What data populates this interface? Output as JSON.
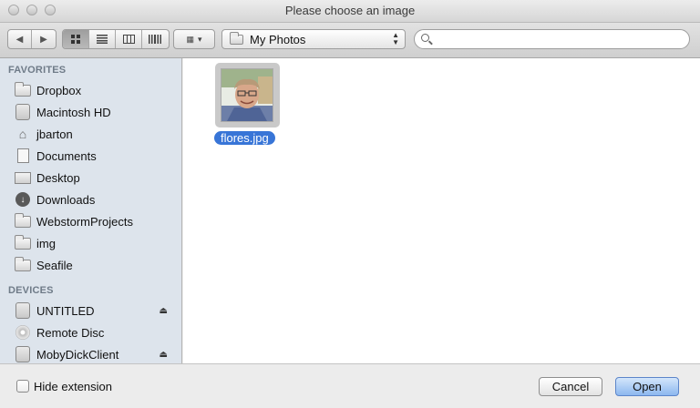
{
  "window": {
    "title": "Please choose an image"
  },
  "toolbar": {
    "back_icon": "◀",
    "forward_icon": "▶",
    "view_modes": [
      "icon-view",
      "list-view",
      "column-view",
      "coverflow-view"
    ],
    "arrange_icon": "▦",
    "arrange_caret": "▾",
    "location": "My Photos",
    "location_updown": "▲▼",
    "search_value": "",
    "search_placeholder": ""
  },
  "sidebar": {
    "favorites_header": "FAVORITES",
    "favorites": [
      {
        "label": "Dropbox",
        "icon": "folder-icon"
      },
      {
        "label": "Macintosh HD",
        "icon": "hard-disk-icon"
      },
      {
        "label": "jbarton",
        "icon": "home-icon"
      },
      {
        "label": "Documents",
        "icon": "documents-icon"
      },
      {
        "label": "Desktop",
        "icon": "desktop-icon"
      },
      {
        "label": "Downloads",
        "icon": "downloads-icon"
      },
      {
        "label": "WebstormProjects",
        "icon": "folder-icon"
      },
      {
        "label": "img",
        "icon": "folder-icon"
      },
      {
        "label": "Seafile",
        "icon": "folder-icon"
      }
    ],
    "devices_header": "DEVICES",
    "devices": [
      {
        "label": "UNTITLED",
        "icon": "disk-icon",
        "eject": "⏏"
      },
      {
        "label": "Remote Disc",
        "icon": "cd-icon"
      },
      {
        "label": "MobyDickClient",
        "icon": "disk-icon",
        "eject": "⏏"
      }
    ]
  },
  "main": {
    "files": [
      {
        "name": "flores.jpg",
        "selected": true
      }
    ]
  },
  "bottom": {
    "hide_extension_label": "Hide extension",
    "hide_extension_checked": false,
    "cancel_label": "Cancel",
    "open_label": "Open"
  },
  "colors": {
    "selection": "#3875d7",
    "sidebar_bg": "#dde4ec",
    "default_button": "#8cb7ef"
  }
}
